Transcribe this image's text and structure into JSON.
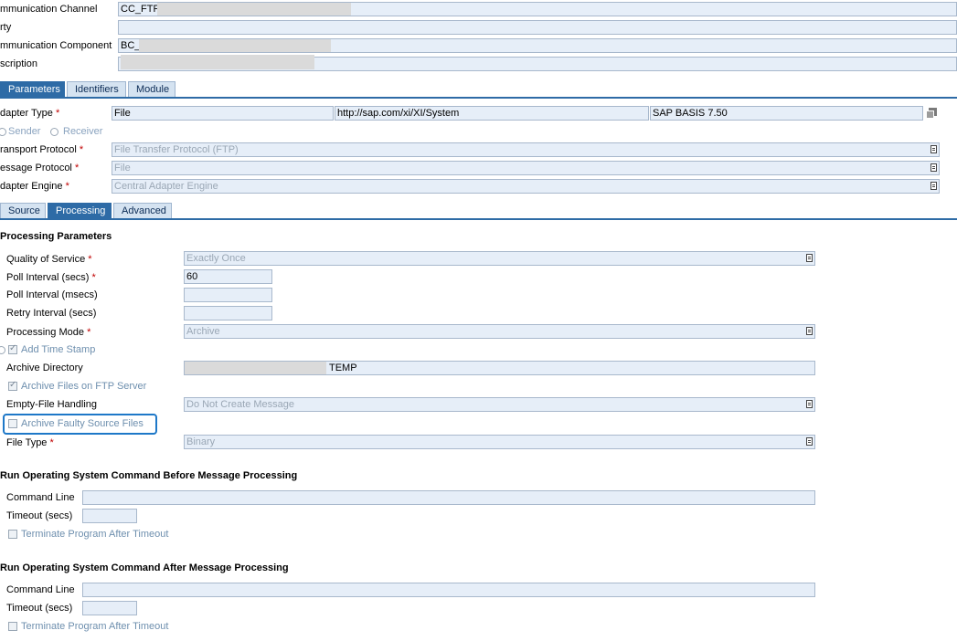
{
  "header": {
    "communication_channel": {
      "label": "mmunication Channel",
      "value": "CC_FTP_"
    },
    "party": {
      "label": "rty",
      "value": ""
    },
    "communication_component": {
      "label": "mmunication Component",
      "value": "BC_"
    },
    "description": {
      "label": "scription",
      "value": ""
    }
  },
  "main_tabs": [
    "Parameters",
    "Identifiers",
    "Module"
  ],
  "adapter": {
    "adapter_type_label": "dapter Type",
    "adapter_type_value": "File",
    "namespace_value": "http://sap.com/xi/XI/System",
    "swc_value": "SAP BASIS 7.50",
    "sender_label": "Sender",
    "receiver_label": "Receiver",
    "transport_protocol_label": "ransport Protocol",
    "transport_protocol_value": "File Transfer Protocol (FTP)",
    "message_protocol_label": "essage Protocol",
    "message_protocol_value": "File",
    "adapter_engine_label": "dapter Engine",
    "adapter_engine_value": "Central Adapter Engine",
    "required_mark": "*"
  },
  "sub_tabs": [
    "Source",
    "Processing",
    "Advanced"
  ],
  "processing": {
    "title": "Processing Parameters",
    "qos_label": "Quality of Service",
    "qos_value": "Exactly Once",
    "poll_secs_label": "Poll Interval (secs)",
    "poll_secs_value": "60",
    "poll_msecs_label": "Poll Interval (msecs)",
    "poll_msecs_value": "",
    "retry_label": "Retry Interval (secs)",
    "retry_value": "",
    "mode_label": "Processing Mode",
    "mode_value": "Archive",
    "add_timestamp_label": "Add Time Stamp",
    "archive_dir_label": "Archive Directory",
    "archive_dir_value": "TEMP",
    "archive_ftp_label": "Archive Files on FTP Server",
    "empty_file_label": "Empty-File Handling",
    "empty_file_value": "Do Not Create Message",
    "archive_faulty_label": "Archive Faulty Source Files",
    "file_type_label": "File Type",
    "file_type_value": "Binary"
  },
  "before_cmd": {
    "title": "Run Operating System Command Before Message Processing",
    "command_label": "Command Line",
    "command_value": "",
    "timeout_label": "Timeout (secs)",
    "timeout_value": "",
    "terminate_label": "Terminate Program After Timeout"
  },
  "after_cmd": {
    "title": "Run Operating System Command After Message Processing",
    "command_label": "Command Line",
    "command_value": "",
    "timeout_label": "Timeout (secs)",
    "timeout_value": "",
    "terminate_label": "Terminate Program After Timeout"
  },
  "colors": {
    "accent": "#2e6ba6",
    "field_bg": "#e6eef8",
    "highlight": "#1e78c8",
    "required": "#c00000"
  }
}
